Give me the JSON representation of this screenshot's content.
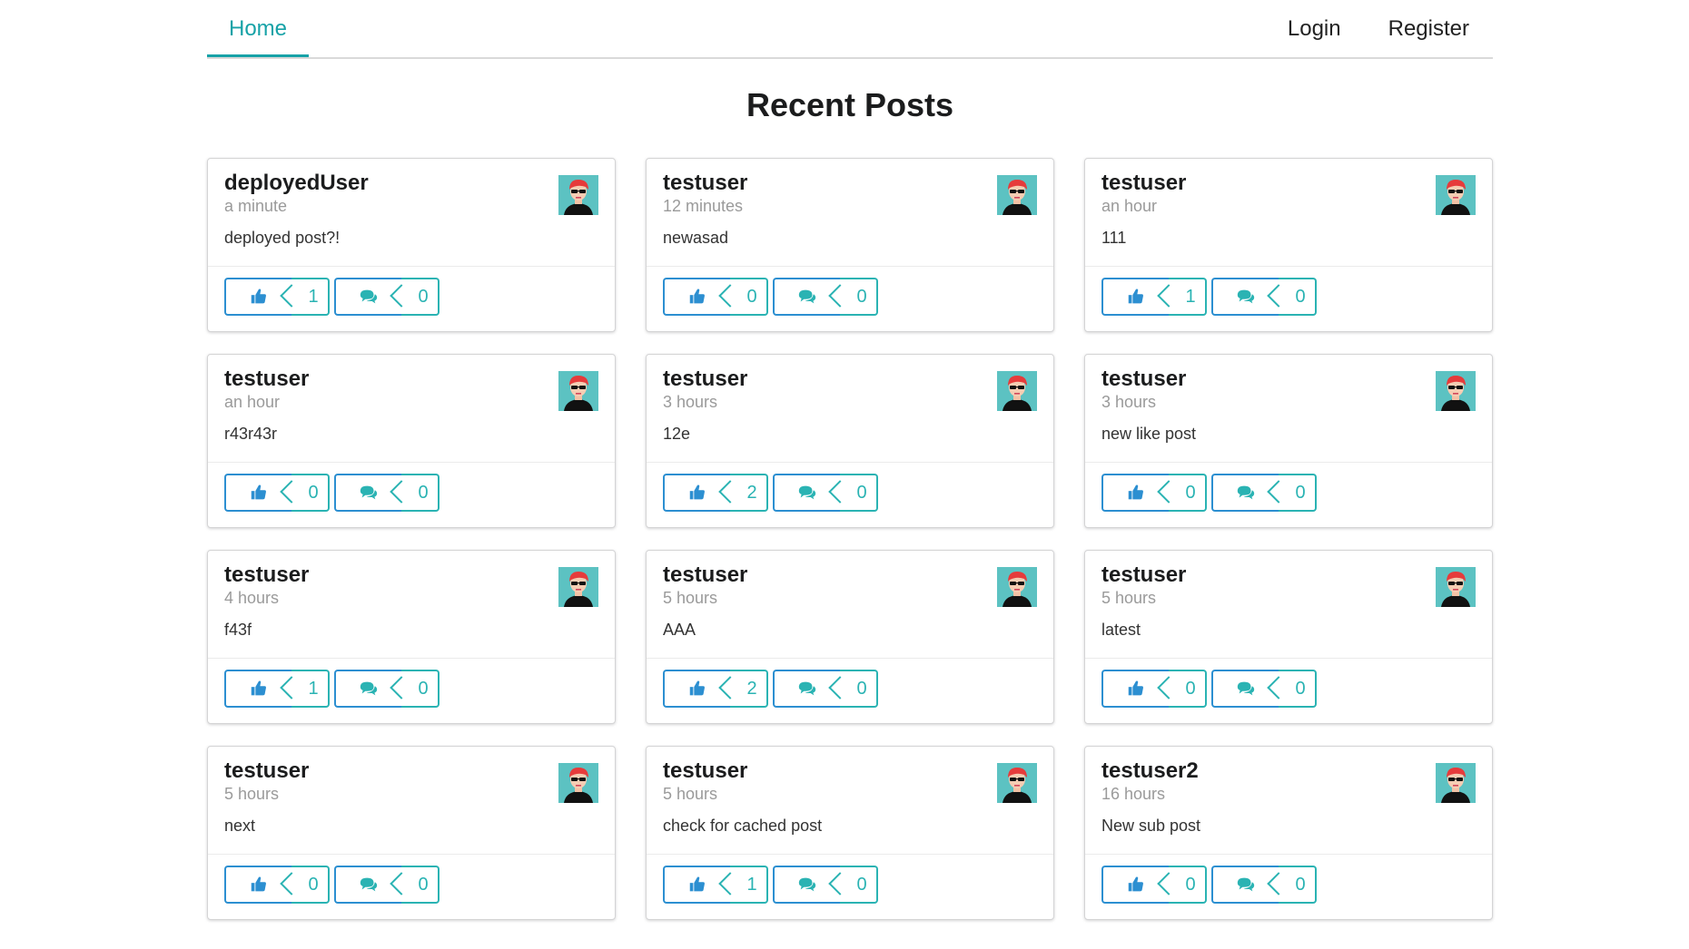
{
  "nav": {
    "home": "Home",
    "login": "Login",
    "register": "Register"
  },
  "page_title": "Recent Posts",
  "colors": {
    "accent": "#17a2a7",
    "like_blue": "#2c8fd1",
    "count_teal": "#2ab3b3"
  },
  "posts": [
    {
      "author": "deployedUser",
      "time": "a minute",
      "content": "deployed post?!",
      "likes": "1",
      "comments": "0"
    },
    {
      "author": "testuser",
      "time": "12 minutes",
      "content": "newasad",
      "likes": "0",
      "comments": "0"
    },
    {
      "author": "testuser",
      "time": "an hour",
      "content": "111",
      "likes": "1",
      "comments": "0"
    },
    {
      "author": "testuser",
      "time": "an hour",
      "content": "r43r43r",
      "likes": "0",
      "comments": "0"
    },
    {
      "author": "testuser",
      "time": "3 hours",
      "content": "12e",
      "likes": "2",
      "comments": "0"
    },
    {
      "author": "testuser",
      "time": "3 hours",
      "content": "new like post",
      "likes": "0",
      "comments": "0"
    },
    {
      "author": "testuser",
      "time": "4 hours",
      "content": "f43f",
      "likes": "1",
      "comments": "0"
    },
    {
      "author": "testuser",
      "time": "5 hours",
      "content": "AAA",
      "likes": "2",
      "comments": "0"
    },
    {
      "author": "testuser",
      "time": "5 hours",
      "content": "latest",
      "likes": "0",
      "comments": "0"
    },
    {
      "author": "testuser",
      "time": "5 hours",
      "content": "next",
      "likes": "0",
      "comments": "0"
    },
    {
      "author": "testuser",
      "time": "5 hours",
      "content": "check for cached post",
      "likes": "1",
      "comments": "0"
    },
    {
      "author": "testuser2",
      "time": "16 hours",
      "content": "New sub post",
      "likes": "0",
      "comments": "0"
    }
  ]
}
